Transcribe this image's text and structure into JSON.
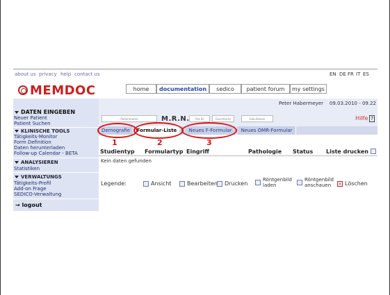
{
  "toplinks": {
    "about": "about us",
    "privacy": "privacy",
    "help": "help",
    "contact": "contact us"
  },
  "languages": [
    "EN",
    "DE",
    "FR",
    "IT",
    "ES"
  ],
  "logo": "MEMDOC",
  "nav": [
    "home",
    "documentation",
    "sedico",
    "patient forum",
    "my settings"
  ],
  "user": "Peter Habermeyer",
  "date": "09.03.2010 - 09.22",
  "sidebar": {
    "daten_head": "DATEN EINGEBEN",
    "neuer_patient": "Neuer Patient",
    "patient_suchen": "Patient Suchen",
    "tools_head": "KLINISCHE TOOLS",
    "taetigkeits_monitor": "Tätigkeits-Monitor",
    "form_definition": "Form Definition",
    "daten_herunterladen": "Daten herunterladen",
    "follow_up": "Follow-up Calendar - BETA",
    "analysieren_head": "ANALYSIEREN",
    "statistiken": "Statistiken",
    "verwaltung_head": "VERWALTUNGS",
    "taetigkeits_profil": "Tätigkeits-Profil",
    "add_on": "Add-on Frage",
    "sedico_verwaltung": "SEDICO-Verwaltung",
    "logout": "logout"
  },
  "search": {
    "vorname": "Patientname",
    "mrn": "M.R.N.:",
    "patid": "Pat.ID",
    "geschlecht": "Geschlecht",
    "gebdatum": "Geb.Datum",
    "hilfe": "Hilfe",
    "hilfe_icon": "?"
  },
  "subtabs": [
    "Demografie",
    "Formular-Liste",
    "Neues F-Formular",
    "Neues OMR-Formular"
  ],
  "table": {
    "headers": [
      "Studientyp",
      "Formulartyp",
      "Eingriff",
      "Pathologie",
      "Status",
      "Liste drucken"
    ],
    "empty": "Kein daten gefunden"
  },
  "legend": {
    "label": "Legende:",
    "ansicht": "Ansicht",
    "bearbeiten": "Bearbeiten",
    "drucken": "Drucken",
    "roentgen_laden_1": "Röntgenbild",
    "roentgen_laden_2": "laden",
    "roentgen_anschauen_1": "Röntgenbild",
    "roentgen_anschauen_2": "anschauen",
    "loeschen": "Löschen"
  },
  "annotations": [
    "1",
    "2",
    "3"
  ],
  "colors": {
    "logo_red": "#cc1f1f",
    "annotation_red": "#dd1111",
    "sidebar_bg": "#dde3f2",
    "nav_active": "#2a4a9a"
  }
}
